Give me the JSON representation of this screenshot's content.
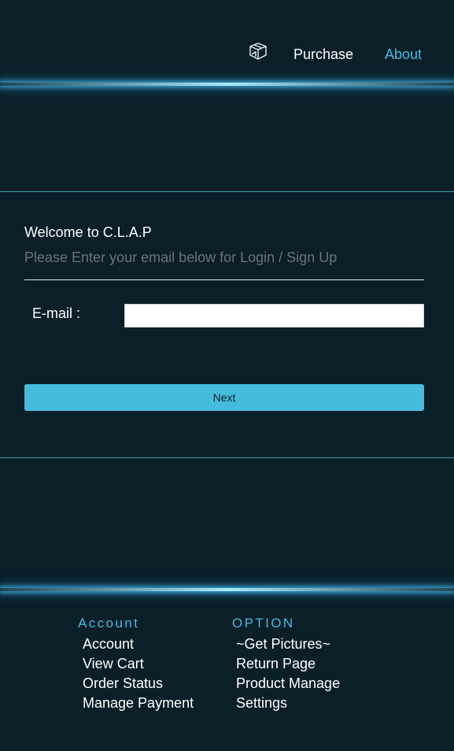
{
  "header": {
    "logo_icon": "box-icon",
    "nav": {
      "purchase": "Purchase",
      "about": "About"
    },
    "active_color": "#44bbe0"
  },
  "login": {
    "welcome": "Welcome to C.L.A.P",
    "subtitle": "Please Enter your email below for Login / Sign Up",
    "email_label": "E-mail :",
    "email_value": "",
    "email_placeholder": "",
    "next_label": "Next",
    "button_color": "#45bcdb"
  },
  "footer": {
    "account": {
      "heading": "Account",
      "items": [
        "Account",
        "View Cart",
        "Order Status",
        "Manage Payment"
      ]
    },
    "option": {
      "heading": "OPTION",
      "items": [
        "~Get Pictures~",
        "Return Page",
        "Product Manage",
        "Settings"
      ]
    }
  },
  "colors": {
    "background": "#0a1f28",
    "accent": "#44bbe0",
    "glow": "#a9ecff"
  }
}
